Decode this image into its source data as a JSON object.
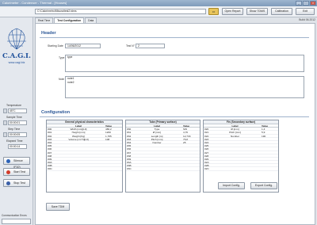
{
  "window": {
    "title": "Calorimeter - Condenser - Thermal - [Houses]"
  },
  "toolbar": {
    "path": "C:\\Calorimetro\\Misura\\test2.tdms",
    "open_report": "Open Report",
    "show_tdms": "Show TDMS",
    "calibration": "Calibration",
    "exit": "Exit"
  },
  "tabs": [
    "Real Time",
    "Test Configuration",
    "Data"
  ],
  "build": "Build 06.2012",
  "logo": {
    "text": "C.A.G.I.",
    "url": "www.cagi.biz"
  },
  "sidebar": {
    "temperature_label": "Temperature",
    "temperature": "45°C",
    "sample_time_label": "Sample Time",
    "sample_time": "00:00:01",
    "step_time_label": "Step Time",
    "step_time": "00:00:05",
    "elapsed_label": "Elapsed Time",
    "elapsed": "00:00:14",
    "silence": "Silence (F10)",
    "start": "Start Test",
    "stop": "Stop Test",
    "comm_label": "Communication Errors"
  },
  "header": {
    "title": "Header",
    "starting_date_label": "Starting Date",
    "starting_date": "14/06/2012",
    "test_n_label": "Test N°",
    "test_n": "2",
    "type_label": "Type",
    "type_value": "type",
    "note_label": "Note",
    "note_lines": [
      "note1",
      "note2"
    ]
  },
  "config": {
    "title": "Configuration",
    "col_label": "Label",
    "col_value": "Value",
    "general": {
      "title": "General physical characteristics",
      "rows": [
        [
          "#00",
          "Width [mm][L0]",
          "480,2"
        ],
        [
          "#01",
          "Height [mm]",
          "1200"
        ],
        [
          "#02",
          "Weight [Kg]",
          "1,765"
        ],
        [
          "#03",
          "Volume [cm^3][L0]",
          "108"
        ],
        [
          "#04",
          "",
          ""
        ],
        [
          "#05",
          "",
          ""
        ],
        [
          "#06",
          "",
          ""
        ],
        [
          "#07",
          "",
          ""
        ],
        [
          "#08",
          "",
          ""
        ],
        [
          "#09",
          "",
          ""
        ],
        [
          "#0A",
          "",
          ""
        ],
        [
          "#0B",
          "",
          ""
        ],
        [
          "#0C",
          "",
          ""
        ]
      ]
    },
    "tube": {
      "title": "Tube (Primary surface)",
      "rows": [
        [
          "#30",
          "Type",
          "SW"
        ],
        [
          "#31",
          "Ø [mm]",
          "4,76"
        ],
        [
          "#32",
          "Length [m]",
          "12,733"
        ],
        [
          "#33",
          "Pitch [mm]",
          "76,8"
        ],
        [
          "#34",
          "Number",
          "25"
        ],
        [
          "#35",
          "",
          ""
        ],
        [
          "#36",
          "",
          ""
        ],
        [
          "#37",
          "",
          ""
        ],
        [
          "#38",
          "",
          ""
        ],
        [
          "#39",
          "",
          ""
        ],
        [
          "#3A",
          "",
          ""
        ],
        [
          "#3B",
          "",
          ""
        ],
        [
          "#3C",
          "",
          ""
        ]
      ]
    },
    "fin": {
      "title": "Fin (Secondary surface)",
      "rows": [
        [
          "#20",
          "Ø [mm]",
          "1,4"
        ],
        [
          "#21",
          "Pitch [mm]",
          "5,9"
        ],
        [
          "#22",
          "Number",
          "190"
        ],
        [
          "#23",
          "",
          ""
        ],
        [
          "#24",
          "",
          ""
        ],
        [
          "#25",
          "",
          ""
        ],
        [
          "#26",
          "",
          ""
        ],
        [
          "#27",
          "",
          ""
        ],
        [
          "#28",
          "",
          ""
        ],
        [
          "#29",
          "",
          ""
        ],
        [
          "#2A",
          "",
          ""
        ],
        [
          "#2B",
          "",
          ""
        ],
        [
          "#2C",
          "",
          ""
        ]
      ]
    },
    "import": "Import Config.",
    "export": "Export Config."
  },
  "save": "Save TDM"
}
